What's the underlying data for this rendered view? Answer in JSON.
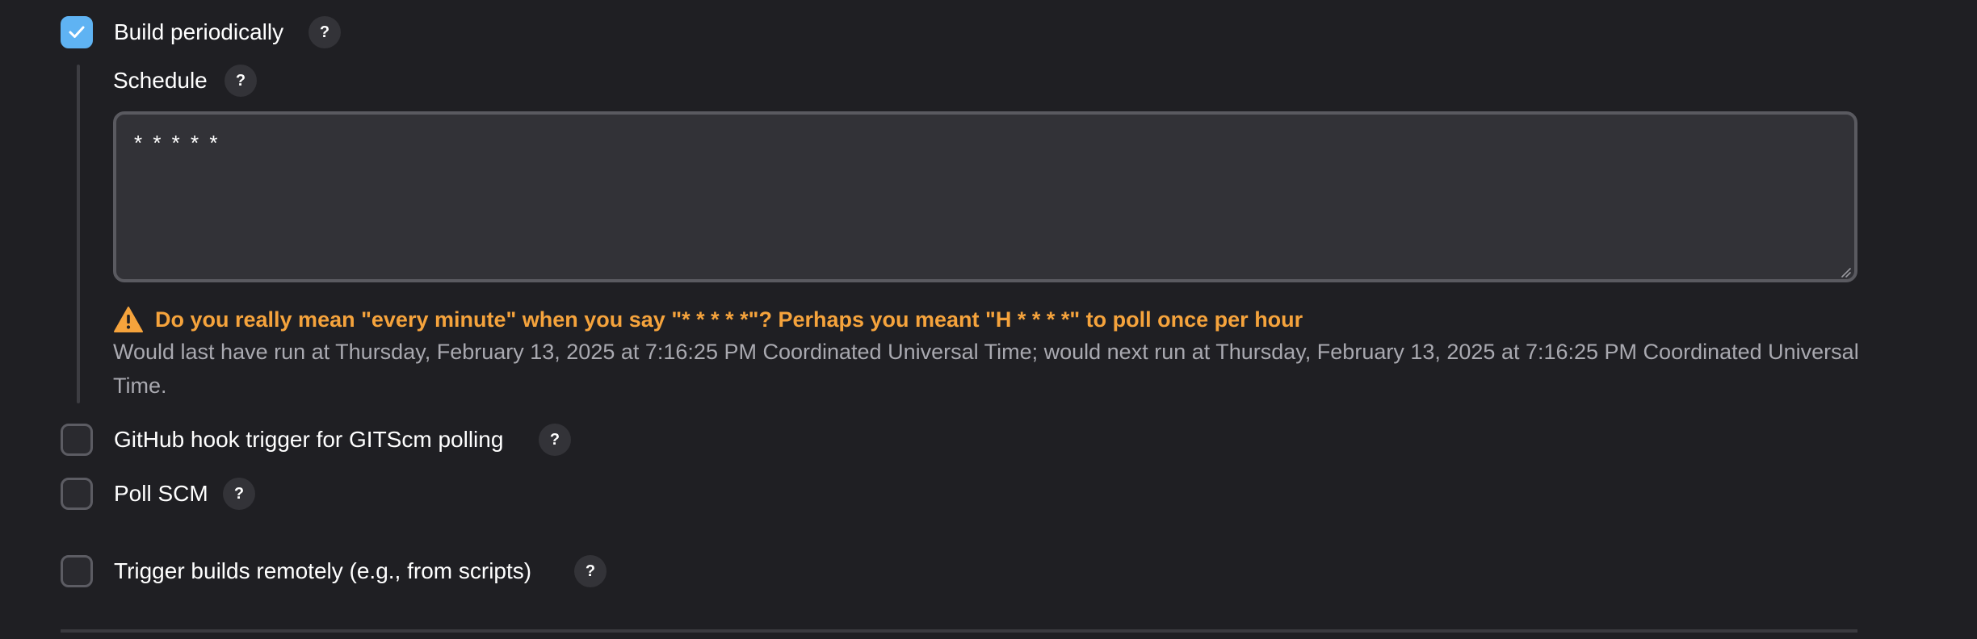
{
  "triggers": {
    "build_periodically": {
      "label": "Build periodically",
      "checked": true,
      "help": "?"
    },
    "schedule": {
      "label": "Schedule",
      "help": "?",
      "value": "* * * * *"
    },
    "warning": {
      "text": "Do you really mean \"every minute\" when you say \"* * * * *\"? Perhaps you meant \"H * * * *\" to poll once per hour",
      "icon": "warning-icon",
      "color": "#f5a33c"
    },
    "info": {
      "text": "Would last have run at Thursday, February 13, 2025 at 7:16:25 PM Coordinated Universal Time; would next run at Thursday, February 13, 2025 at 7:16:25 PM Coordinated Universal Time."
    },
    "github_hook": {
      "label": "GitHub hook trigger for GITScm polling",
      "checked": false,
      "help": "?"
    },
    "poll_scm": {
      "label": "Poll SCM",
      "checked": false,
      "help": "?"
    },
    "trigger_remotely": {
      "label": "Trigger builds remotely (e.g., from scripts)",
      "checked": false,
      "help": "?"
    }
  },
  "colors": {
    "background": "#1f1f23",
    "checkbox_checked": "#5fb3f3",
    "warning": "#f5a33c",
    "muted_text": "#a9a9b0"
  }
}
